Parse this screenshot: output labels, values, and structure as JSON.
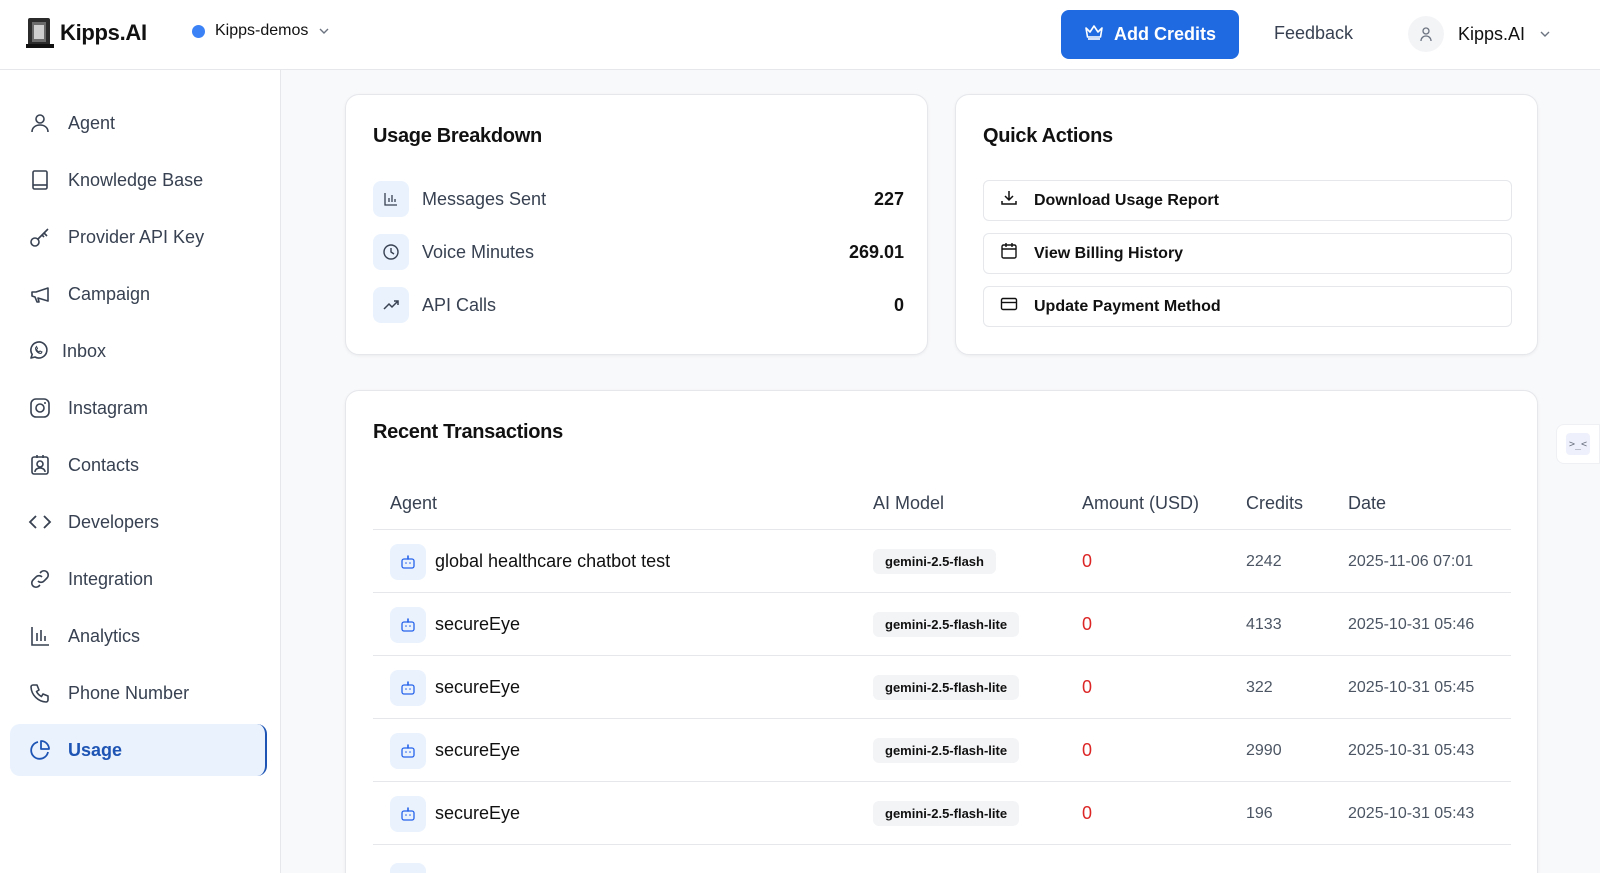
{
  "header": {
    "logo_text": "Kipps.AI",
    "workspace": "Kipps-demos",
    "add_credits": "Add Credits",
    "feedback": "Feedback",
    "user_name": "Kipps.AI",
    "accent_color": "#1f6ae0",
    "workspace_dot_color": "#3b82f6"
  },
  "sidebar": {
    "items": [
      {
        "label": "Agent",
        "icon": "user-icon"
      },
      {
        "label": "Knowledge Base",
        "icon": "book-icon"
      },
      {
        "label": "Provider API Key",
        "icon": "key-icon"
      },
      {
        "label": "Campaign",
        "icon": "megaphone-icon"
      },
      {
        "label": "Inbox",
        "icon": "whatsapp-icon"
      },
      {
        "label": "Instagram",
        "icon": "instagram-icon"
      },
      {
        "label": "Contacts",
        "icon": "contact-card-icon"
      },
      {
        "label": "Developers",
        "icon": "code-icon"
      },
      {
        "label": "Integration",
        "icon": "link-icon"
      },
      {
        "label": "Analytics",
        "icon": "bar-chart-icon"
      },
      {
        "label": "Phone Number",
        "icon": "phone-icon"
      },
      {
        "label": "Usage",
        "icon": "pie-chart-icon",
        "active": true
      }
    ]
  },
  "usage_breakdown": {
    "title": "Usage Breakdown",
    "rows": [
      {
        "label": "Messages Sent",
        "value": "227",
        "icon": "bar-chart-icon"
      },
      {
        "label": "Voice Minutes",
        "value": "269.01",
        "icon": "clock-icon"
      },
      {
        "label": "API Calls",
        "value": "0",
        "icon": "trending-up-icon"
      }
    ]
  },
  "quick_actions": {
    "title": "Quick Actions",
    "buttons": [
      {
        "label": "Download Usage Report",
        "icon": "download-icon"
      },
      {
        "label": "View Billing History",
        "icon": "calendar-icon"
      },
      {
        "label": "Update Payment Method",
        "icon": "credit-card-icon"
      }
    ]
  },
  "transactions": {
    "title": "Recent Transactions",
    "columns": [
      "Agent",
      "AI Model",
      "Amount (USD)",
      "Credits",
      "Date"
    ],
    "rows": [
      {
        "agent": "global healthcare chatbot test",
        "model": "gemini-2.5-flash",
        "amount": "0",
        "credits": "2242",
        "date": "2025-11-06 07:01"
      },
      {
        "agent": "secureEye",
        "model": "gemini-2.5-flash-lite",
        "amount": "0",
        "credits": "4133",
        "date": "2025-10-31 05:46"
      },
      {
        "agent": "secureEye",
        "model": "gemini-2.5-flash-lite",
        "amount": "0",
        "credits": "322",
        "date": "2025-10-31 05:45"
      },
      {
        "agent": "secureEye",
        "model": "gemini-2.5-flash-lite",
        "amount": "0",
        "credits": "2990",
        "date": "2025-10-31 05:43"
      },
      {
        "agent": "secureEye",
        "model": "gemini-2.5-flash-lite",
        "amount": "0",
        "credits": "196",
        "date": "2025-10-31 05:43"
      }
    ],
    "amount_color": "#dc2626"
  },
  "side_widget": {
    "glyph": ">_<"
  }
}
